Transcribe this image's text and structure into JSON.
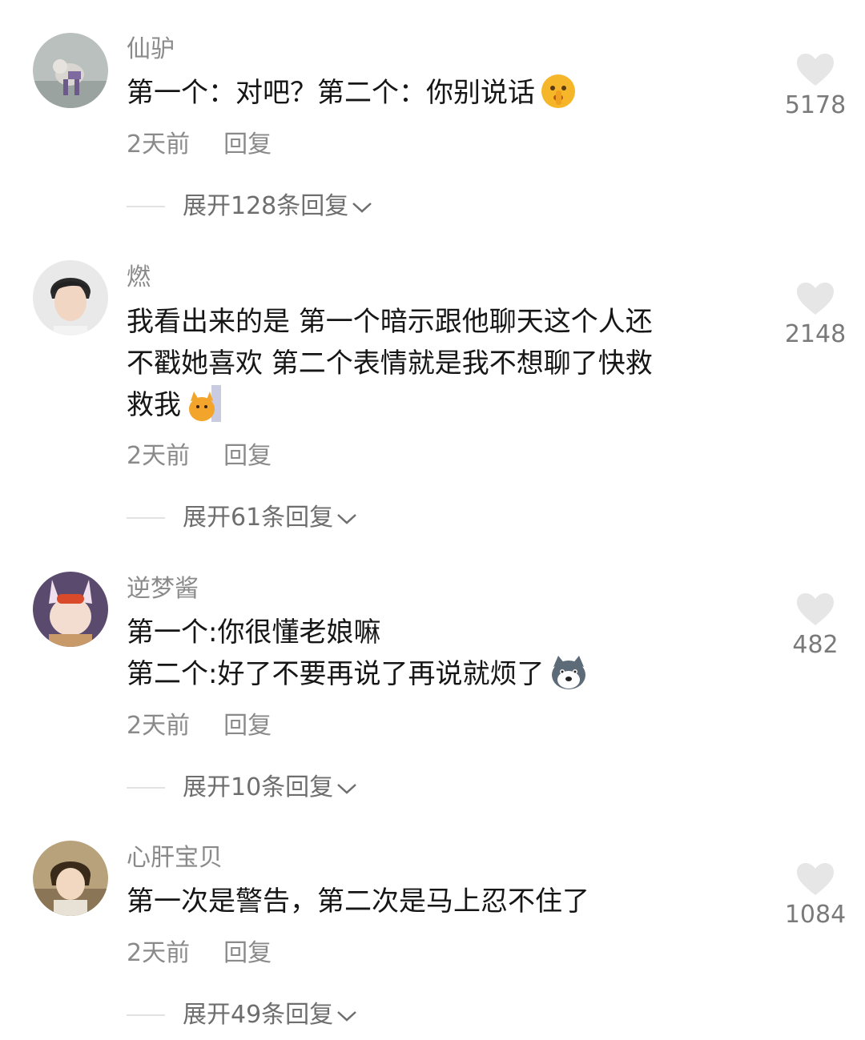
{
  "comments": [
    {
      "username": "仙驴",
      "lines": [
        "第一个：对吧？第二个：你别说话"
      ],
      "emoji": "shushing-face-emoji",
      "time": "2天前",
      "reply": "回复",
      "expand": "展开128条回复",
      "likes": "5178"
    },
    {
      "username": "燃",
      "lines": [
        "我看出来的是 第一个暗示跟他聊天这个人还",
        "不戳她喜欢 第二个表情就是我不想聊了快救",
        "救我"
      ],
      "emoji": "cat-peeking-emoji",
      "time": "2天前",
      "reply": "回复",
      "expand": "展开61条回复",
      "likes": "2148"
    },
    {
      "username": "逆梦酱",
      "lines": [
        "第一个:你很懂老娘嘛",
        "第二个:好了不要再说了再说就烦了"
      ],
      "emoji": "husky-dog-emoji",
      "time": "2天前",
      "reply": "回复",
      "expand": "展开10条回复",
      "likes": "482"
    },
    {
      "username": "心肝宝贝",
      "lines": [
        "第一次是警告，第二次是马上忍不住了"
      ],
      "emoji": "",
      "time": "2天前",
      "reply": "回复",
      "expand": "展开49条回复",
      "likes": "1084"
    }
  ],
  "colors": {
    "username": "#8a8a8a",
    "text": "#161616",
    "heart": "#e6e6e6",
    "likes": "#7a7a7a"
  }
}
